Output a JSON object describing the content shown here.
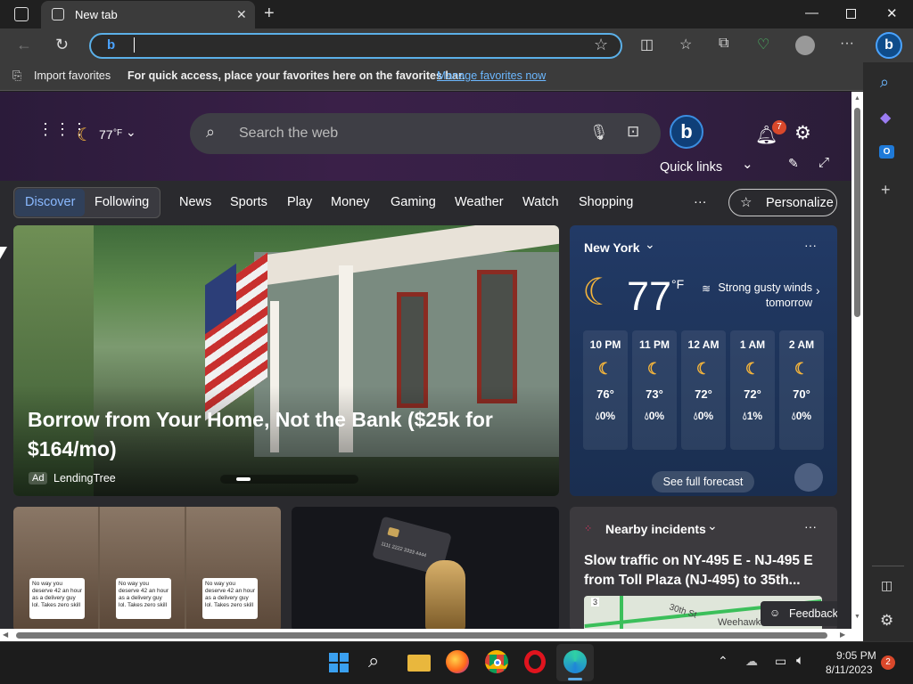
{
  "browser": {
    "tab_title": "New tab",
    "address_value": "",
    "favbar": {
      "import_label": "Import favorites",
      "hint": "For quick access, place your favorites here on the favorites bar.",
      "manage_link": "Manage favorites now"
    }
  },
  "page": {
    "weather_chip": "77",
    "weather_chip_unit": "°F",
    "search_placeholder": "Search the web",
    "notif_count": "7",
    "quick_links": "Quick links",
    "nav": {
      "discover": "Discover",
      "following": "Following",
      "items": [
        "News",
        "Sports",
        "Play",
        "Money",
        "Gaming",
        "Weather",
        "Watch",
        "Shopping"
      ],
      "more": "···",
      "personalize": "Personalize"
    },
    "hero": {
      "headline": "Borrow from Your Home, Not the Bank ($25k for $164/mo)",
      "ad_badge": "Ad",
      "sponsor": "LendingTree"
    },
    "weather": {
      "city": "New York",
      "temp": "77",
      "unit": "°F",
      "alert": "Strong gusty winds tomorrow",
      "hours": [
        {
          "time": "10 PM",
          "temp": "76°",
          "precip": "0%"
        },
        {
          "time": "11 PM",
          "temp": "73°",
          "precip": "0%"
        },
        {
          "time": "12 AM",
          "temp": "72°",
          "precip": "0%"
        },
        {
          "time": "1 AM",
          "temp": "72°",
          "precip": "1%"
        },
        {
          "time": "2 AM",
          "temp": "70°",
          "precip": "0%"
        }
      ],
      "forecast_button": "See full forecast"
    },
    "card2": {
      "caption": "No way you deserve 42 an hour as a delivery guy lol. Takes zero skill"
    },
    "card3": {
      "card_number": "1111 2222 3333 4444"
    },
    "incidents": {
      "title": "Nearby incidents",
      "headline": "Slow traffic on NY-495 E - NJ-495 E from Toll Plaza (NJ-495) to 35th...",
      "map_labels": [
        "30th St",
        "Weehawken",
        "3"
      ],
      "feedback": "Feedback"
    }
  },
  "taskbar": {
    "time": "9:05 PM",
    "date": "8/11/2023",
    "notif_badge": "2"
  }
}
